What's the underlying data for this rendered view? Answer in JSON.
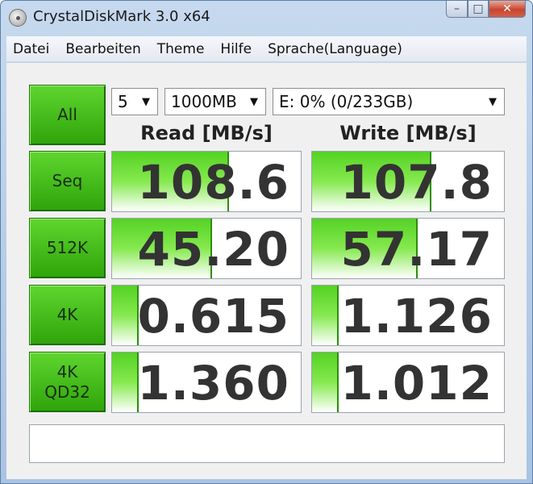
{
  "window": {
    "title": "CrystalDiskMark 3.0 x64"
  },
  "menu": [
    "Datei",
    "Bearbeiten",
    "Theme",
    "Hilfe",
    "Sprache(Language)"
  ],
  "controls": {
    "all_label": "All",
    "count": "5",
    "size": "1000MB",
    "drive": "E: 0% (0/233GB)"
  },
  "headers": {
    "read": "Read [MB/s]",
    "write": "Write [MB/s]"
  },
  "rows": [
    {
      "label": "Seq",
      "read": "108.6",
      "write": "107.8"
    },
    {
      "label": "512K",
      "read": "45.20",
      "write": "57.17"
    },
    {
      "label": "4K",
      "read": "0.615",
      "write": "1.126"
    },
    {
      "label": "4K",
      "label2": "QD32",
      "read": "1.360",
      "write": "1.012"
    }
  ],
  "bar_fill_fraction": {
    "read": [
      0.62,
      0.53,
      0.14,
      0.14
    ],
    "write": [
      0.62,
      0.55,
      0.14,
      0.14
    ]
  },
  "status_text": "",
  "colors": {
    "accent_green": "#3cb816",
    "title_bg": "#b8cfe9",
    "close_red": "#c7452e"
  }
}
